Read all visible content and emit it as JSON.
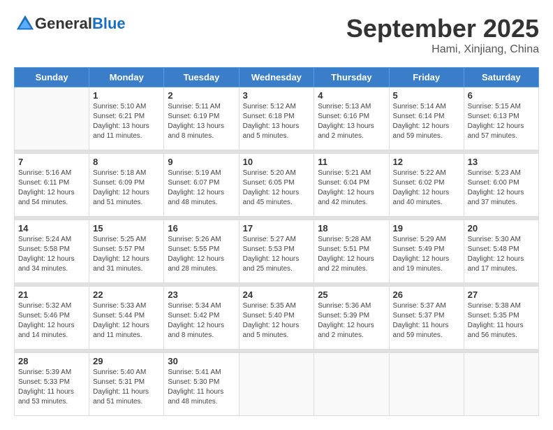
{
  "header": {
    "logo_general": "General",
    "logo_blue": "Blue",
    "month": "September 2025",
    "location": "Hami, Xinjiang, China"
  },
  "days_of_week": [
    "Sunday",
    "Monday",
    "Tuesday",
    "Wednesday",
    "Thursday",
    "Friday",
    "Saturday"
  ],
  "weeks": [
    [
      {
        "day": "",
        "info": ""
      },
      {
        "day": "1",
        "info": "Sunrise: 5:10 AM\nSunset: 6:21 PM\nDaylight: 13 hours\nand 11 minutes."
      },
      {
        "day": "2",
        "info": "Sunrise: 5:11 AM\nSunset: 6:19 PM\nDaylight: 13 hours\nand 8 minutes."
      },
      {
        "day": "3",
        "info": "Sunrise: 5:12 AM\nSunset: 6:18 PM\nDaylight: 13 hours\nand 5 minutes."
      },
      {
        "day": "4",
        "info": "Sunrise: 5:13 AM\nSunset: 6:16 PM\nDaylight: 13 hours\nand 2 minutes."
      },
      {
        "day": "5",
        "info": "Sunrise: 5:14 AM\nSunset: 6:14 PM\nDaylight: 12 hours\nand 59 minutes."
      },
      {
        "day": "6",
        "info": "Sunrise: 5:15 AM\nSunset: 6:13 PM\nDaylight: 12 hours\nand 57 minutes."
      }
    ],
    [
      {
        "day": "7",
        "info": "Sunrise: 5:16 AM\nSunset: 6:11 PM\nDaylight: 12 hours\nand 54 minutes."
      },
      {
        "day": "8",
        "info": "Sunrise: 5:18 AM\nSunset: 6:09 PM\nDaylight: 12 hours\nand 51 minutes."
      },
      {
        "day": "9",
        "info": "Sunrise: 5:19 AM\nSunset: 6:07 PM\nDaylight: 12 hours\nand 48 minutes."
      },
      {
        "day": "10",
        "info": "Sunrise: 5:20 AM\nSunset: 6:05 PM\nDaylight: 12 hours\nand 45 minutes."
      },
      {
        "day": "11",
        "info": "Sunrise: 5:21 AM\nSunset: 6:04 PM\nDaylight: 12 hours\nand 42 minutes."
      },
      {
        "day": "12",
        "info": "Sunrise: 5:22 AM\nSunset: 6:02 PM\nDaylight: 12 hours\nand 40 minutes."
      },
      {
        "day": "13",
        "info": "Sunrise: 5:23 AM\nSunset: 6:00 PM\nDaylight: 12 hours\nand 37 minutes."
      }
    ],
    [
      {
        "day": "14",
        "info": "Sunrise: 5:24 AM\nSunset: 5:58 PM\nDaylight: 12 hours\nand 34 minutes."
      },
      {
        "day": "15",
        "info": "Sunrise: 5:25 AM\nSunset: 5:57 PM\nDaylight: 12 hours\nand 31 minutes."
      },
      {
        "day": "16",
        "info": "Sunrise: 5:26 AM\nSunset: 5:55 PM\nDaylight: 12 hours\nand 28 minutes."
      },
      {
        "day": "17",
        "info": "Sunrise: 5:27 AM\nSunset: 5:53 PM\nDaylight: 12 hours\nand 25 minutes."
      },
      {
        "day": "18",
        "info": "Sunrise: 5:28 AM\nSunset: 5:51 PM\nDaylight: 12 hours\nand 22 minutes."
      },
      {
        "day": "19",
        "info": "Sunrise: 5:29 AM\nSunset: 5:49 PM\nDaylight: 12 hours\nand 19 minutes."
      },
      {
        "day": "20",
        "info": "Sunrise: 5:30 AM\nSunset: 5:48 PM\nDaylight: 12 hours\nand 17 minutes."
      }
    ],
    [
      {
        "day": "21",
        "info": "Sunrise: 5:32 AM\nSunset: 5:46 PM\nDaylight: 12 hours\nand 14 minutes."
      },
      {
        "day": "22",
        "info": "Sunrise: 5:33 AM\nSunset: 5:44 PM\nDaylight: 12 hours\nand 11 minutes."
      },
      {
        "day": "23",
        "info": "Sunrise: 5:34 AM\nSunset: 5:42 PM\nDaylight: 12 hours\nand 8 minutes."
      },
      {
        "day": "24",
        "info": "Sunrise: 5:35 AM\nSunset: 5:40 PM\nDaylight: 12 hours\nand 5 minutes."
      },
      {
        "day": "25",
        "info": "Sunrise: 5:36 AM\nSunset: 5:39 PM\nDaylight: 12 hours\nand 2 minutes."
      },
      {
        "day": "26",
        "info": "Sunrise: 5:37 AM\nSunset: 5:37 PM\nDaylight: 11 hours\nand 59 minutes."
      },
      {
        "day": "27",
        "info": "Sunrise: 5:38 AM\nSunset: 5:35 PM\nDaylight: 11 hours\nand 56 minutes."
      }
    ],
    [
      {
        "day": "28",
        "info": "Sunrise: 5:39 AM\nSunset: 5:33 PM\nDaylight: 11 hours\nand 53 minutes."
      },
      {
        "day": "29",
        "info": "Sunrise: 5:40 AM\nSunset: 5:31 PM\nDaylight: 11 hours\nand 51 minutes."
      },
      {
        "day": "30",
        "info": "Sunrise: 5:41 AM\nSunset: 5:30 PM\nDaylight: 11 hours\nand 48 minutes."
      },
      {
        "day": "",
        "info": ""
      },
      {
        "day": "",
        "info": ""
      },
      {
        "day": "",
        "info": ""
      },
      {
        "day": "",
        "info": ""
      }
    ]
  ]
}
